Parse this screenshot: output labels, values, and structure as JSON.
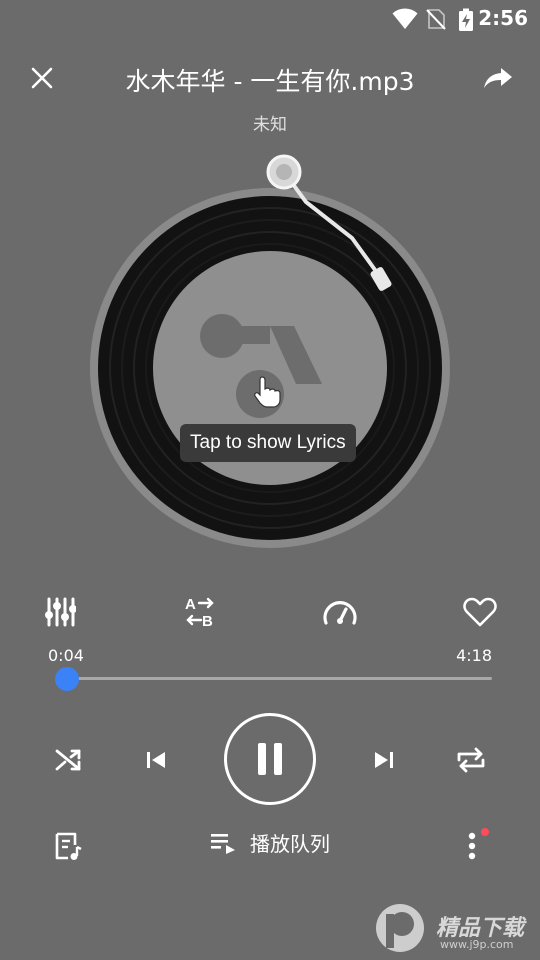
{
  "status_bar": {
    "time": "2:56"
  },
  "header": {
    "title": "水木年华 - 一生有你.mp3",
    "artist": "未知"
  },
  "disc": {
    "tooltip": "Tap to show Lyrics"
  },
  "tools": [
    {
      "icon": "equalizer-icon"
    },
    {
      "icon": "ab-repeat-icon"
    },
    {
      "icon": "speed-icon"
    },
    {
      "icon": "heart-icon"
    }
  ],
  "progress": {
    "current": "0:04",
    "total": "4:18",
    "fraction": 0.016
  },
  "controls": [
    {
      "icon": "shuffle-icon"
    },
    {
      "icon": "previous-icon"
    },
    {
      "icon": "pause-icon"
    },
    {
      "icon": "next-icon"
    },
    {
      "icon": "repeat-icon"
    }
  ],
  "bottom": {
    "queue_label": "播放队列",
    "lyrics_icon": "lyrics-icon",
    "more_icon": "more-vertical-icon"
  },
  "watermark": {
    "text": "精品下载",
    "sub": "www.j9p.com"
  },
  "colors": {
    "background": "#6b6b6b",
    "accent": "#3b82f6",
    "badge": "#ff4b5c"
  }
}
